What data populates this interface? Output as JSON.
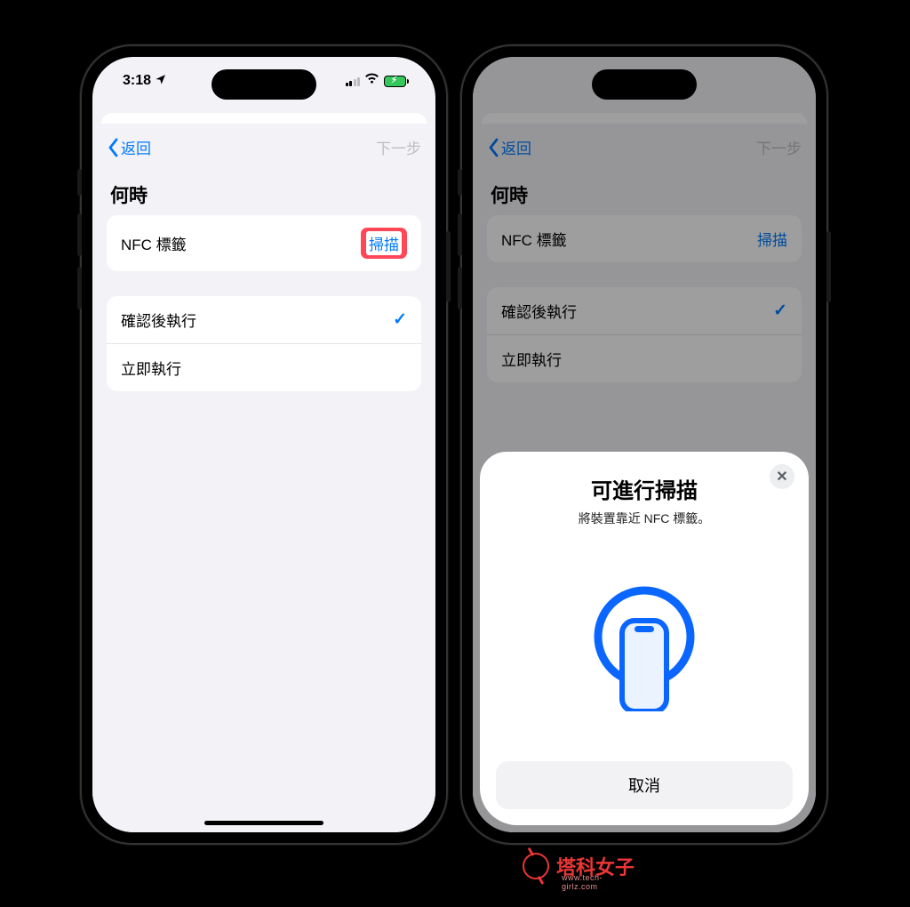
{
  "status": {
    "time": "3:18",
    "location_arrow": "location-arrow-icon",
    "signal_icon": "cellular-signal-icon",
    "wifi_icon": "wifi-icon",
    "battery_icon": "battery-charging-icon"
  },
  "colors": {
    "ios_blue": "#007aff",
    "ios_green": "#34c759",
    "red_highlight": "#ff4757",
    "sheet_bg": "#f2f2f7"
  },
  "nav": {
    "back_label": "返回",
    "next_label": "下一步"
  },
  "section": {
    "when_header": "何時"
  },
  "nfc_row": {
    "label": "NFC 標籤",
    "action": "掃描"
  },
  "options": [
    {
      "label": "確認後執行",
      "selected": true
    },
    {
      "label": "立即執行",
      "selected": false
    }
  ],
  "nfc_modal": {
    "title": "可進行掃描",
    "subtitle": "將裝置靠近 NFC 標籤。",
    "cancel_label": "取消",
    "close_icon": "close-icon",
    "illustration": "phone-nfc-scan-icon"
  },
  "watermark": {
    "text": "塔科女子",
    "url": "www.tech-girlz.com"
  }
}
